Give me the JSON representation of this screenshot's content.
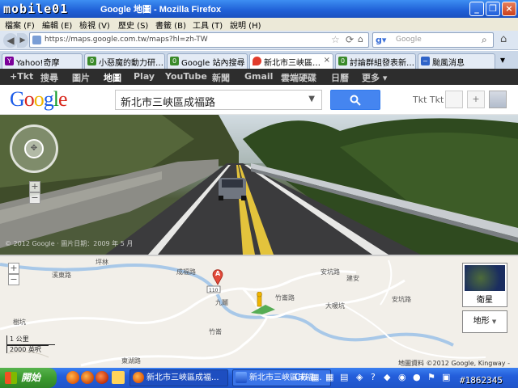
{
  "window": {
    "logo_text": "mobile01",
    "title": "Google 地圖 - Mozilla Firefox"
  },
  "menu": [
    "檔案 (F)",
    "編輯 (E)",
    "檢視 (V)",
    "歷史 (S)",
    "書籤 (B)",
    "工具 (T)",
    "說明 (H)"
  ],
  "navbar": {
    "url": "https://maps.google.com.tw/maps?hl=zh-TW",
    "search_placeholder": "Google"
  },
  "tabs": [
    {
      "label": "Yahoo!奇摩",
      "icon_color": "#7b0099",
      "icon": "Y!"
    },
    {
      "label": "小惡魔的動力研…",
      "icon_color": "#3a8a2a",
      "icon": "01"
    },
    {
      "label": "Google 站內搜尋 …",
      "icon_color": "#3a8a2a",
      "icon": "01"
    },
    {
      "label": "新北市三峽區…",
      "icon_color": "#e23b2b",
      "icon": "pin",
      "active": true
    },
    {
      "label": "討論群組發表新…",
      "icon_color": "#3a8a2a",
      "icon": "01"
    },
    {
      "label": "颱風消息",
      "icon_color": "#3064c8",
      "icon": "~"
    }
  ],
  "google_bar": [
    "+Tkt",
    "搜尋",
    "圖片",
    "地圖",
    "Play",
    "YouTube",
    "新聞",
    "Gmail",
    "雲端硬碟",
    "日曆",
    "更多 ▾"
  ],
  "google_bar_active": "地圖",
  "header": {
    "query": "新北市三峽區成福路",
    "user": "Tkt Tkt"
  },
  "streetview": {
    "copyright": "© 2012 Google · 圖片日期：2009 年 5 月"
  },
  "map": {
    "labels": [
      {
        "text": "坪林"
      },
      {
        "text": "溪東路"
      },
      {
        "text": "成福路"
      },
      {
        "text": "安坑路"
      },
      {
        "text": "建安"
      },
      {
        "text": "九鬮"
      },
      {
        "text": "竹崙路"
      },
      {
        "text": "大暖坑"
      },
      {
        "text": "樹坑"
      },
      {
        "text": "竹崙"
      },
      {
        "text": "東湖路"
      },
      {
        "text": "安坑路"
      }
    ],
    "route_shield": "110",
    "marker_letter": "A",
    "scale_metric": "1 公里",
    "scale_imperial": "2000 英呎",
    "satellite_label": "衛星",
    "terrain_label": "地形",
    "copyright": "地圖資料 ©2012 Google, Kingway -"
  },
  "taskbar": {
    "start": "開始",
    "buttons": [
      "新北市三峽區成福...",
      "新北市三峽區成福..."
    ],
    "tray_lang": "CH"
  },
  "watermark": "#1862345"
}
